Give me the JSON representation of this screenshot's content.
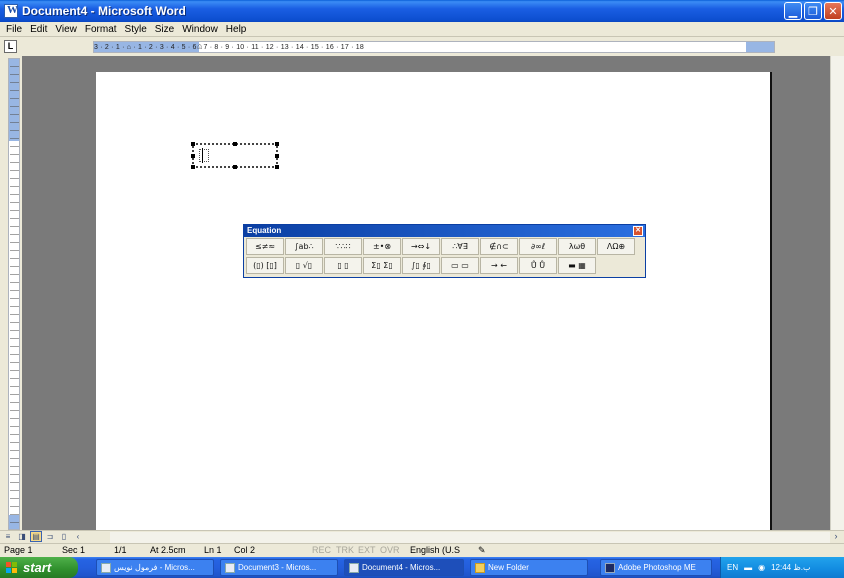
{
  "window": {
    "title": "Document4 - Microsoft Word"
  },
  "menu": [
    "File",
    "Edit",
    "View",
    "Format",
    "Style",
    "Size",
    "Window",
    "Help"
  ],
  "ruler": {
    "corner": "L",
    "ticks": "3 · 2 · 1 · ⌂ · 1 · 2 · 3 · 4 · 5 · 6 · 7 · 8 · 9 · 10 · 11 · 12 · 13 · 14 · 15 · 16 · 17 · 18"
  },
  "equation_toolbar": {
    "title": "Equation",
    "row1": [
      "≤≠≈",
      "∫ab∴",
      "∵∴∷",
      "±•⊗",
      "→⇔↓",
      "∴∀∃",
      "∉∩⊂",
      "∂∞ℓ",
      "λωθ",
      "ΛΩ⊕"
    ],
    "row2": [
      "(▯) [▯]",
      "▯ √▯",
      "▯ ▯",
      "Σ▯ Σ▯",
      "∫▯ ∮▯",
      "▭ ▭",
      "→ ←",
      "Ů Ů",
      "▬ ▦"
    ]
  },
  "statusbar": {
    "page": "Page 1",
    "sec": "Sec 1",
    "pages": "1/1",
    "at": "At 2.5cm",
    "ln": "Ln 1",
    "col": "Col 2",
    "rec": "REC",
    "trk": "TRK",
    "ext": "EXT",
    "ovr": "OVR",
    "lang": "English (U.S"
  },
  "taskbar": {
    "start": "start",
    "tasks": [
      "فرمول نويس - Micros...",
      "Document3 - Micros...",
      "Document4 - Micros...",
      "New Folder",
      "Adobe Photoshop ME"
    ],
    "tray_lang": "EN",
    "tray_time": "12:44 ب.ظ"
  }
}
